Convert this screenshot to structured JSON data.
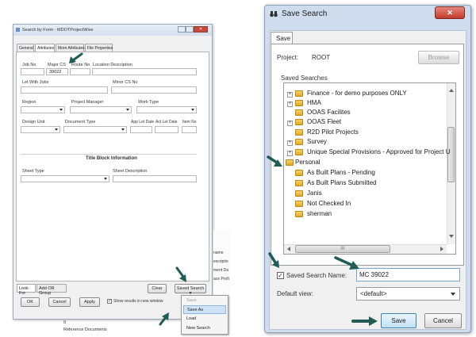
{
  "left_window": {
    "title": "Search by Form - MDOTProjectWise",
    "tabs": [
      "General",
      "Attributes",
      "More Attributes",
      "File Properties"
    ],
    "fields": {
      "job_no": "Job No",
      "major_cs": "Major CS",
      "major_cs_value": "39022",
      "route_no": "Route No",
      "location_description": "Location Description",
      "let_with_jobs": "Let With Jobs",
      "minor_cs_no": "Minor CS No",
      "region": "Region",
      "project_manager": "Project Manager",
      "work_type": "Work Type",
      "design_unit": "Design Unit",
      "document_type": "Document Type",
      "app_let_date": "App Let Date",
      "act_let_date": "Act Let Date",
      "item_no": "Item No",
      "sheet_type": "Sheet Type",
      "sheet_description": "Sheet Description"
    },
    "section_title": "Title Block Information",
    "look_for_label": "Look For",
    "add_or_group": "Add OR Group",
    "ok_button": "OK",
    "cancel_button": "Cancel",
    "apply_button": "Apply",
    "show_results_label": "Show results in new window",
    "clear_button": "Clear",
    "saved_search_button": "Saved Search ▾"
  },
  "dropdown_menu": {
    "items": [
      "Save",
      "Save As",
      "Load",
      "New Search"
    ]
  },
  "background_fragments": {
    "col_texts": [
      "name",
      "escriptio",
      "ment Da",
      "ace Profi"
    ],
    "row_zero": "0",
    "reference_documents": "Reference Documents"
  },
  "save_search_dialog": {
    "title": "Save Search",
    "tab": "Save",
    "project_label": "Project:",
    "project_value": "ROOT",
    "browse_button": "Browse",
    "saved_searches_label": "Saved Searches",
    "tree_items": [
      "Finance - for demo purposes ONLY",
      "HMA",
      "OOAS Facilites",
      "OOAS Fleet",
      "R2D Pilot Projects",
      "Survey",
      "Unique Special Provisions - Approved for Project U",
      "Personal",
      "As Built Plans - Pending",
      "As Built Plans Submitted",
      "Janis",
      "Not Checked In",
      "sherman"
    ],
    "saved_search_name_label": "Saved Search Name:",
    "saved_search_name_value": "MC 39022",
    "default_view_label": "Default view:",
    "default_view_value": "<default>",
    "save_button": "Save",
    "cancel_button": "Cancel",
    "close_glyph": "✕",
    "scroll_mid": "III"
  },
  "colors": {
    "arrow": "#1f5c55",
    "title_bar": "#dbe6f3",
    "close_red": "#c9493a",
    "selection_blue": "#3399ff"
  }
}
